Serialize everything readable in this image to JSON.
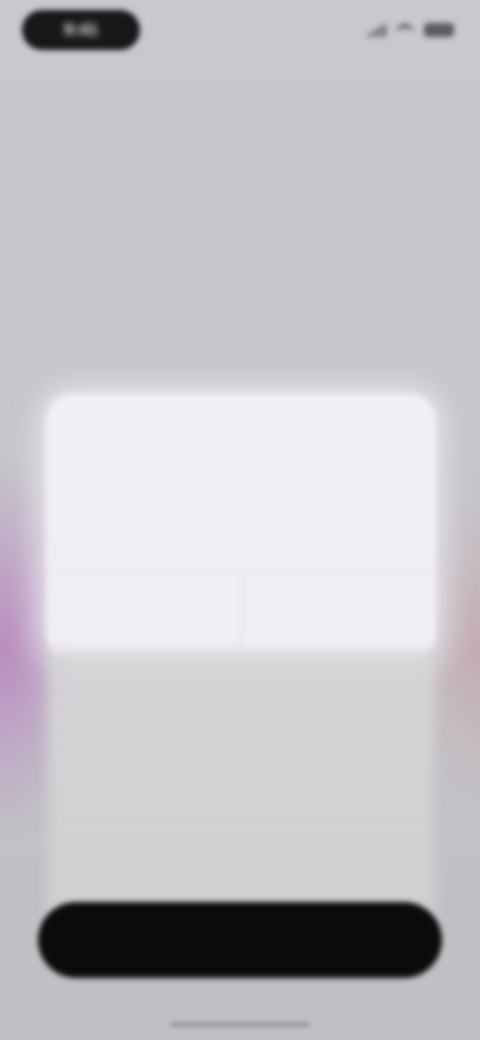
{
  "status_bar": {
    "time": "9:41"
  },
  "page": {
    "step_label": "",
    "headline": ""
  },
  "permission_prompt": {
    "title": "",
    "body": "",
    "deny_label": "",
    "allow_label": ""
  },
  "footer": {
    "helper_text": "",
    "cta_label": ""
  }
}
